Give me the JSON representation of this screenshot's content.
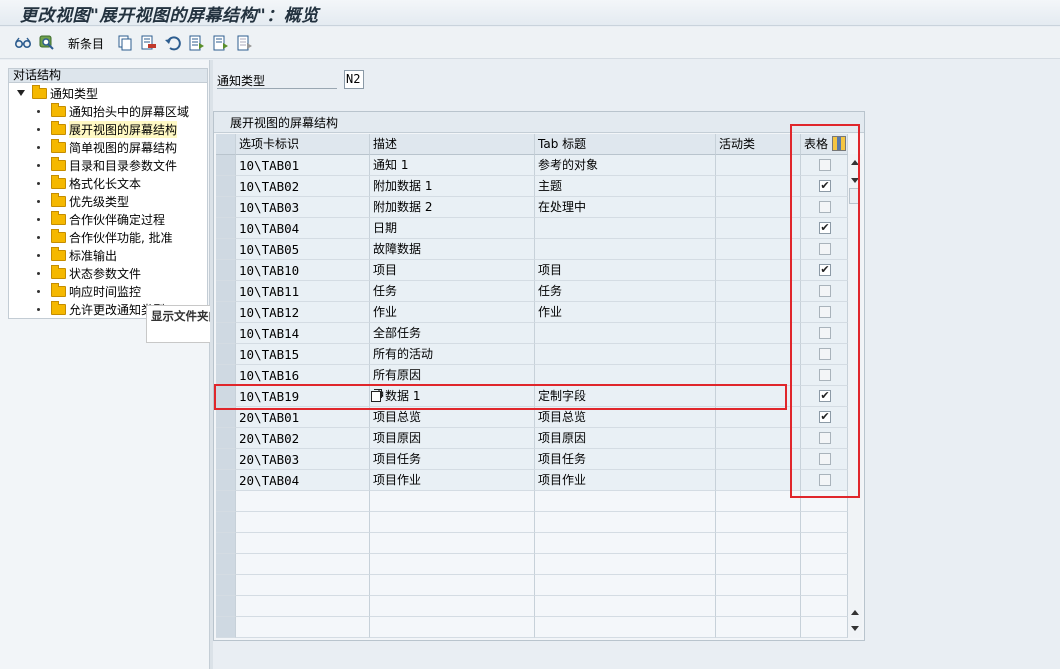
{
  "window": {
    "title": "更改视图\"展开视图的屏幕结构\"：概览"
  },
  "toolbar": {
    "new_entries_label": "新条目",
    "icons": [
      "glasses-icon",
      "search-icon",
      "copy-icon",
      "delete-icon",
      "undo-icon",
      "select-all-icon",
      "select-block-icon",
      "deselect-icon"
    ]
  },
  "tree": {
    "header": "对话结构",
    "root": "通知类型",
    "items": [
      "通知抬头中的屏幕区域",
      "展开视图的屏幕结构",
      "简单视图的屏幕结构",
      "目录和目录参数文件",
      "格式化长文本",
      "优先级类型",
      "合作伙伴确定过程",
      "合作伙伴功能, 批准",
      "标准输出",
      "状态参数文件",
      "响应时间监控",
      "允许更改通知类型"
    ],
    "selected_index": 1,
    "tooltip": "显示文件夹内容"
  },
  "field": {
    "label": "通知类型",
    "value": "N2"
  },
  "table": {
    "title": "展开视图的屏幕结构",
    "columns": [
      "选项卡标识",
      "描述",
      "Tab 标题",
      "活动类",
      "表格"
    ],
    "rows": [
      {
        "id": "10\\TAB01",
        "desc": "通知 1",
        "tab": "参考的对象",
        "cls": "",
        "checked": false
      },
      {
        "id": "10\\TAB02",
        "desc": "附加数据 1",
        "tab": "主题",
        "cls": "",
        "checked": true
      },
      {
        "id": "10\\TAB03",
        "desc": "附加数据 2",
        "tab": "在处理中",
        "cls": "",
        "checked": false
      },
      {
        "id": "10\\TAB04",
        "desc": "日期",
        "tab": "",
        "cls": "",
        "checked": true
      },
      {
        "id": "10\\TAB05",
        "desc": "故障数据",
        "tab": "",
        "cls": "",
        "checked": false
      },
      {
        "id": "10\\TAB10",
        "desc": "项目",
        "tab": "项目",
        "cls": "",
        "checked": true
      },
      {
        "id": "10\\TAB11",
        "desc": "任务",
        "tab": "任务",
        "cls": "",
        "checked": false
      },
      {
        "id": "10\\TAB12",
        "desc": "作业",
        "tab": "作业",
        "cls": "",
        "checked": false
      },
      {
        "id": "10\\TAB14",
        "desc": "全部任务",
        "tab": "",
        "cls": "",
        "checked": false
      },
      {
        "id": "10\\TAB15",
        "desc": "所有的活动",
        "tab": "",
        "cls": "",
        "checked": false
      },
      {
        "id": "10\\TAB16",
        "desc": "所有原因",
        "tab": "",
        "cls": "",
        "checked": false
      },
      {
        "id": "10\\TAB19",
        "desc": "户数据 1",
        "tab": "定制字段",
        "cls": "",
        "checked": true
      },
      {
        "id": "20\\TAB01",
        "desc": "项目总览",
        "tab": "项目总览",
        "cls": "",
        "checked": true
      },
      {
        "id": "20\\TAB02",
        "desc": "项目原因",
        "tab": "项目原因",
        "cls": "",
        "checked": false
      },
      {
        "id": "20\\TAB03",
        "desc": "项目任务",
        "tab": "项目任务",
        "cls": "",
        "checked": false
      },
      {
        "id": "20\\TAB04",
        "desc": "项目作业",
        "tab": "项目作业",
        "cls": "",
        "checked": false
      }
    ],
    "empty_rows": 7,
    "highlight_color": "#e0262b"
  }
}
